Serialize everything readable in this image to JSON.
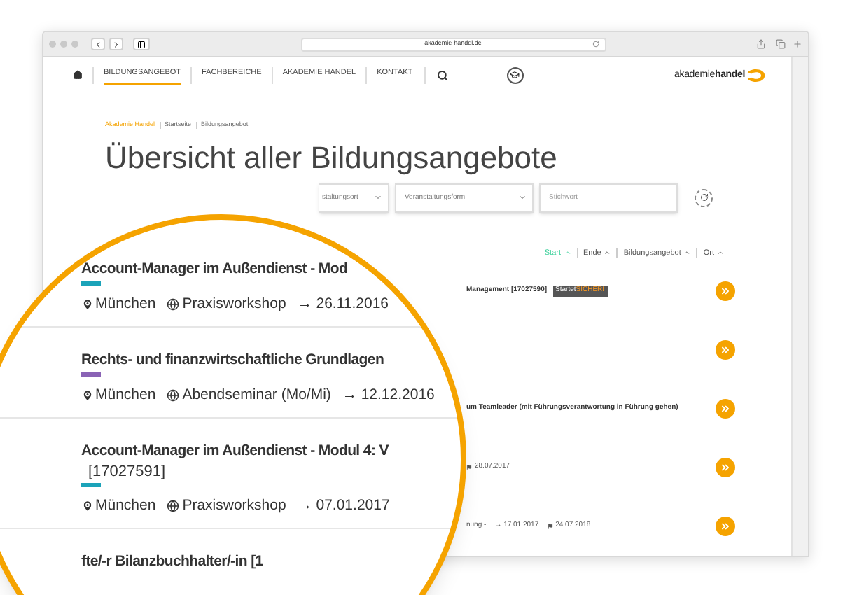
{
  "browser": {
    "url": "akademie-handel.de"
  },
  "nav": {
    "items": [
      {
        "label": "BILDUNGSANGEBOT",
        "selected": true
      },
      {
        "label": "FACHBEREICHE",
        "selected": false
      },
      {
        "label": "AKADEMIE HANDEL",
        "selected": false
      },
      {
        "label": "KONTAKT",
        "selected": false
      }
    ]
  },
  "logo": {
    "light": "akademie",
    "bold": "handel"
  },
  "breadcrumb": [
    {
      "label": "Akademie Handel",
      "link": true
    },
    {
      "label": "Startseite",
      "link": false
    },
    {
      "label": "Bildungsangebot",
      "link": false
    }
  ],
  "title": "Übersicht aller Bildungsangebote",
  "filters": [
    {
      "kind": "select",
      "label": "staltungsort"
    },
    {
      "kind": "select",
      "label": "Veranstaltungsform"
    },
    {
      "kind": "search",
      "placeholder": "Stichwort"
    }
  ],
  "sort": [
    {
      "label": "Start",
      "selected": true
    },
    {
      "label": "Ende",
      "selected": false
    },
    {
      "label": "Bildungsangebot",
      "selected": false
    },
    {
      "label": "Ort",
      "selected": false
    }
  ],
  "list_rows": [
    {
      "kind": "text",
      "text": "Management [17027590]",
      "badge": {
        "label": "Startet",
        "highlight": "SICHER!"
      }
    },
    {
      "kind": "blank"
    },
    {
      "kind": "text",
      "text": "um Teamleader (mit Führungsverantwortung in Führung gehen)"
    },
    {
      "kind": "dates",
      "end": "28.07.2017"
    },
    {
      "kind": "dates",
      "prefix": "nung -",
      "start": "→ 17.01.2017",
      "end": "24.07.2018"
    }
  ],
  "magnifier": {
    "rows": [
      {
        "title": "Account-Manager im Außendienst - Mod",
        "color": "#1ba3b9",
        "location": "München",
        "format": "Praxisworkshop",
        "date": "→ 26.11.2016"
      },
      {
        "title": "Rechts- und finanzwirtschaftliche Grundlagen",
        "color": "#8a63b5",
        "location": "München",
        "format": "Abendseminar (Mo/Mi)",
        "date": "→ 12.12.2016"
      },
      {
        "title": "Account-Manager im Außendienst - Modul 4: V",
        "code": "[17027591]",
        "color": "#1ba3b9",
        "location": "München",
        "format": "Praxisworkshop",
        "date": "→ 07.01.2017"
      },
      {
        "title": "fte/-r Bilanzbuchhalter/-in [1"
      }
    ]
  }
}
